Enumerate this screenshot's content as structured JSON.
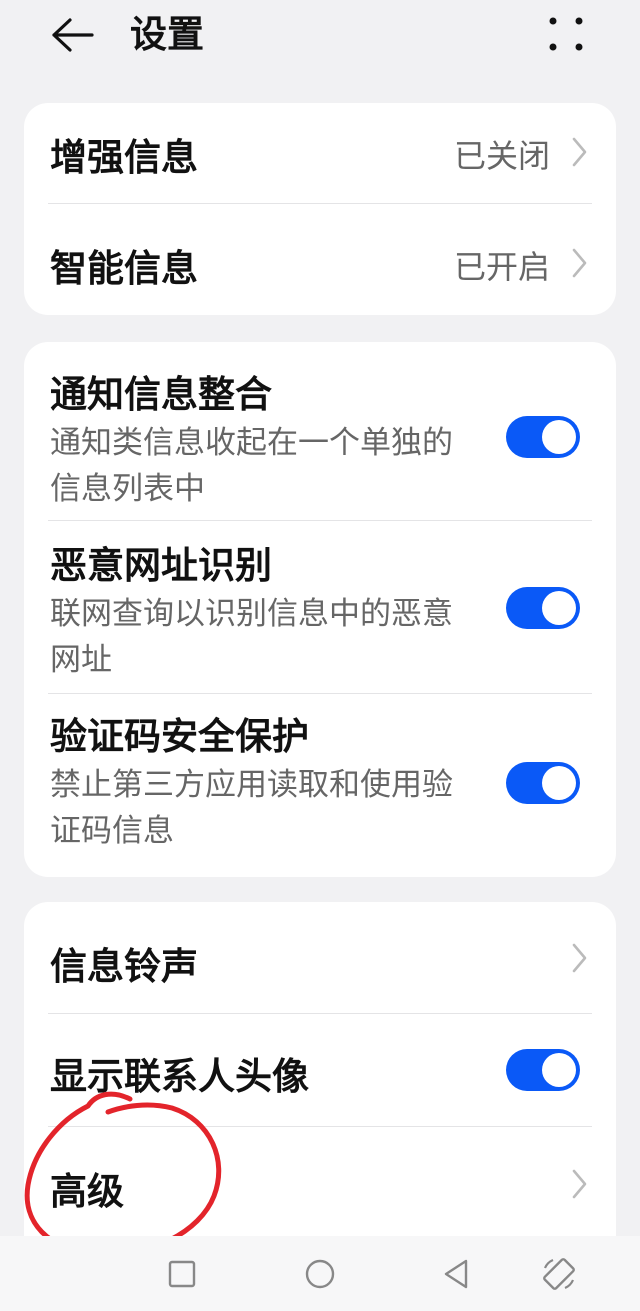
{
  "header": {
    "title": "设置"
  },
  "cards": [
    {
      "rows": [
        {
          "label": "增强信息",
          "value": "已关闭"
        },
        {
          "label": "智能信息",
          "value": "已开启"
        }
      ]
    },
    {
      "rows": [
        {
          "label": "通知信息整合",
          "desc": "通知类信息收起在一个单独的信息列表中",
          "enabled": true
        },
        {
          "label": "恶意网址识别",
          "desc": "联网查询以识别信息中的恶意网址",
          "enabled": true
        },
        {
          "label": "验证码安全保护",
          "desc": "禁止第三方应用读取和使用验证码信息",
          "enabled": true
        }
      ]
    },
    {
      "rows": [
        {
          "label": "信息铃声"
        },
        {
          "label": "显示联系人头像",
          "enabled": true
        },
        {
          "label": "高级"
        }
      ]
    }
  ],
  "colors": {
    "accent": "#0a59f7",
    "annotation": "#e3242b"
  },
  "icons": {
    "back": "arrow-left-icon",
    "more": "more-dots-icon",
    "chevron": "chevron-right-icon",
    "nav": [
      "square-icon",
      "circle-icon",
      "triangle-back-icon",
      "rotate-screen-icon"
    ]
  }
}
